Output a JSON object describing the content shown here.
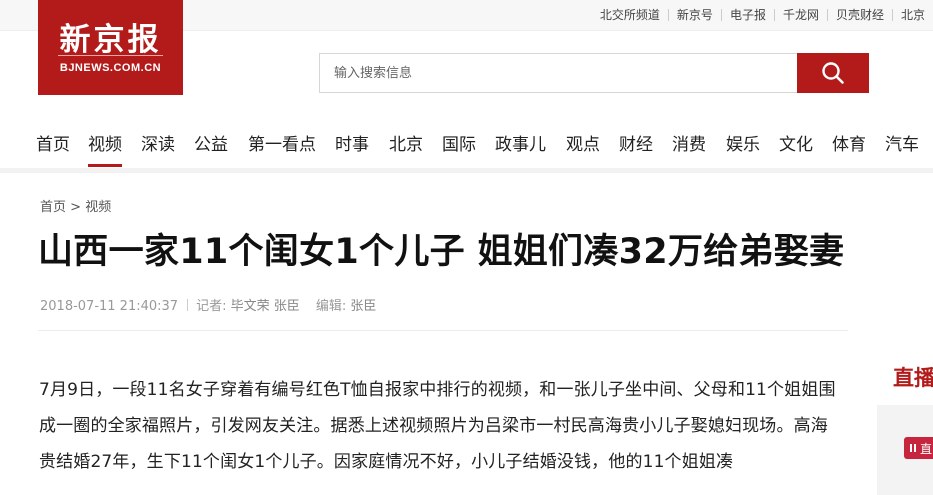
{
  "top_links": [
    "北交所频道",
    "新京号",
    "电子报",
    "千龙网",
    "贝壳财经",
    "北京"
  ],
  "logo": {
    "cn": "新京报",
    "en": "BJNEWS.COM.CN"
  },
  "search": {
    "placeholder": "输入搜索信息",
    "value": "",
    "icon": "search-icon"
  },
  "nav": {
    "items": [
      "首页",
      "视频",
      "深读",
      "公益",
      "第一看点",
      "时事",
      "北京",
      "国际",
      "政事儿",
      "观点",
      "财经",
      "消费",
      "娱乐",
      "文化",
      "体育",
      "汽车"
    ],
    "active": "视频"
  },
  "breadcrumb": {
    "home": "首页",
    "separator": ">",
    "current": "视频"
  },
  "article": {
    "title": "山西一家11个闺女1个儿子 姐姐们凑32万给弟娶妻",
    "date": "2018-07-11 21:40:37",
    "reporter_label": "记者:",
    "reporter": "毕文荣 张臣",
    "editor_label": "编辑:",
    "editor": "张臣",
    "paragraph": "7月9日，一段11名女子穿着有编号红色T恤自报家中排行的视频，和一张儿子坐中间、父母和11个姐姐围成一圈的全家福照片，引发网友关注。据悉上述视频照片为吕梁市一村民高海贵小儿子娶媳妇现场。高海贵结婚27年，生下11个闺女1个儿子。因家庭情况不好，小儿子结婚没钱，他的11个姐姐凑"
  },
  "sidebar": {
    "title": "直播",
    "badge": "直"
  },
  "colors": {
    "brand": "#b31b1b",
    "sidebar_badge": "#c7253d"
  }
}
